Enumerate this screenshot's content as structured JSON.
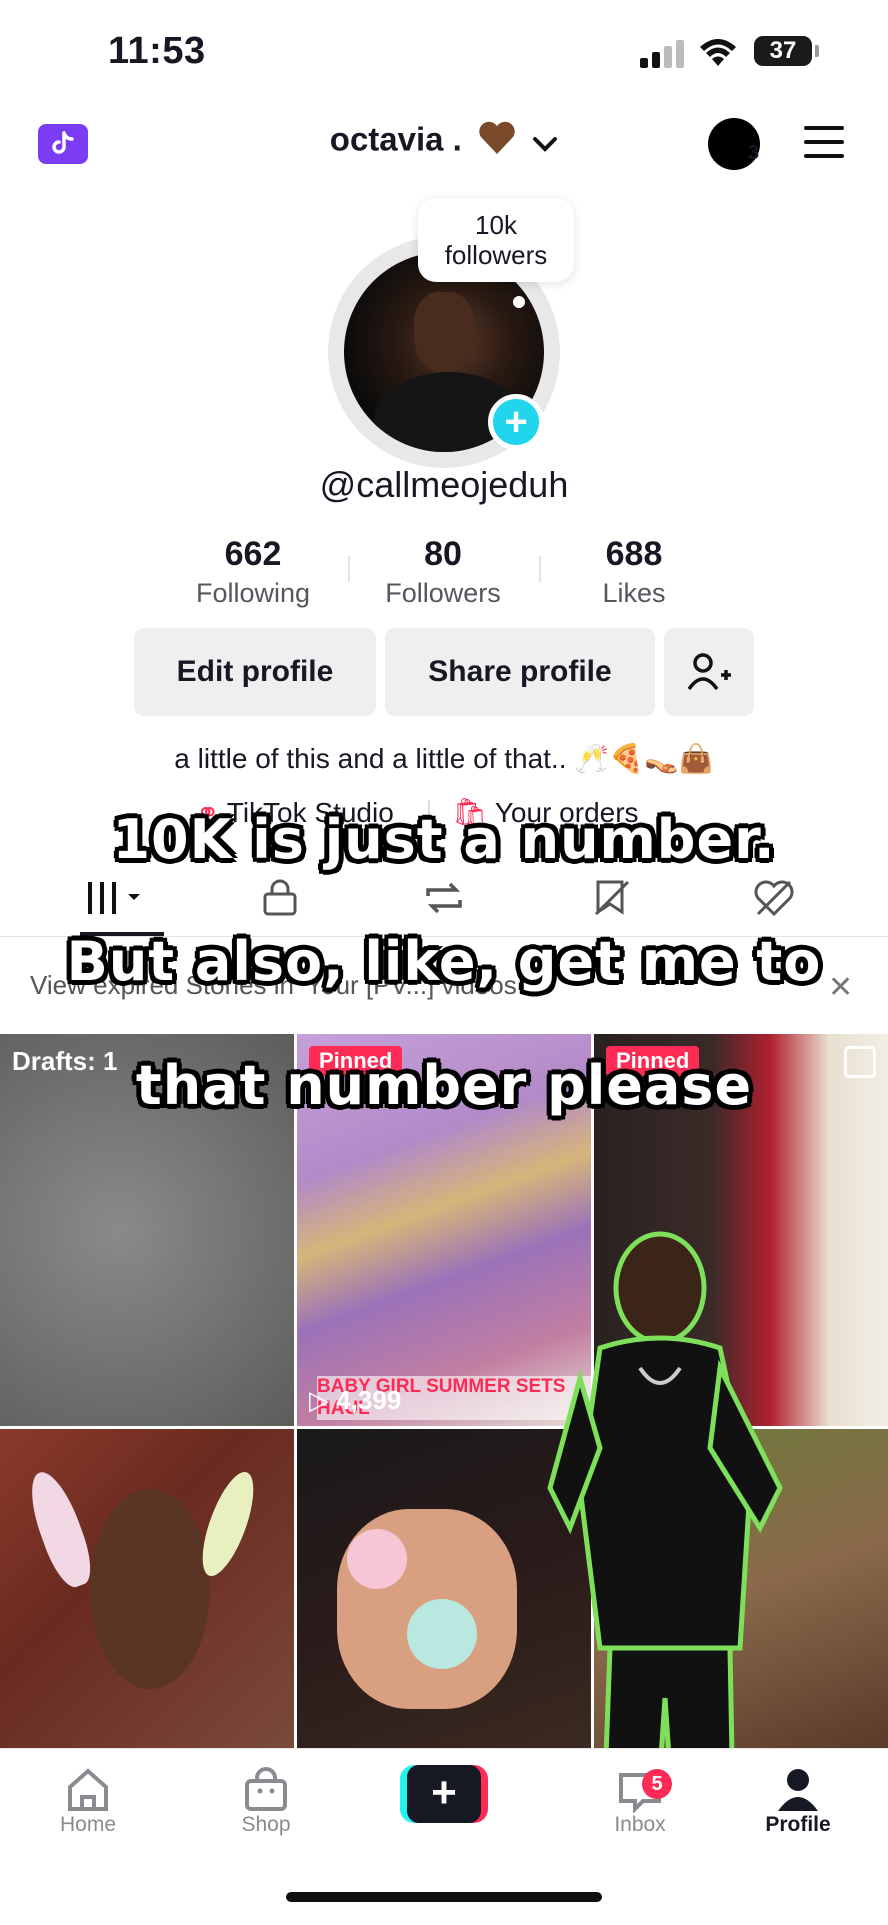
{
  "status_bar": {
    "time": "11:53",
    "battery": "37"
  },
  "header": {
    "username": "octavia .",
    "notification_count": "3"
  },
  "profile": {
    "bubble_count": "10k",
    "bubble_label": "followers",
    "handle": "@callmeojeduh",
    "bio": "a little of this and a little of that.. 🥂🍕👡👜"
  },
  "stats": [
    {
      "value": "662",
      "label": "Following"
    },
    {
      "value": "80",
      "label": "Followers"
    },
    {
      "value": "688",
      "label": "Likes"
    }
  ],
  "buttons": {
    "edit": "Edit profile",
    "share": "Share profile"
  },
  "links": {
    "studio": "TikTok Studio",
    "orders": "Your orders"
  },
  "expired_banner": "View expired Stories in 'Your [PV...] videos",
  "grid": {
    "drafts_label": "Drafts: 1",
    "pinned_label": "Pinned",
    "video2_title": "BABY GIRL SUMMER SETS HAUL",
    "video2_views": "4,399"
  },
  "captions": {
    "line1": "10K is just a number.",
    "line2": "But also, like, get me to",
    "line3": "that number please"
  },
  "bottom_nav": {
    "home": "Home",
    "shop": "Shop",
    "inbox": "Inbox",
    "inbox_badge": "5",
    "profile": "Profile"
  },
  "colors": {
    "accent": "#fe2c55",
    "teal": "#20d5ec",
    "studio": "#7b3cf4"
  }
}
